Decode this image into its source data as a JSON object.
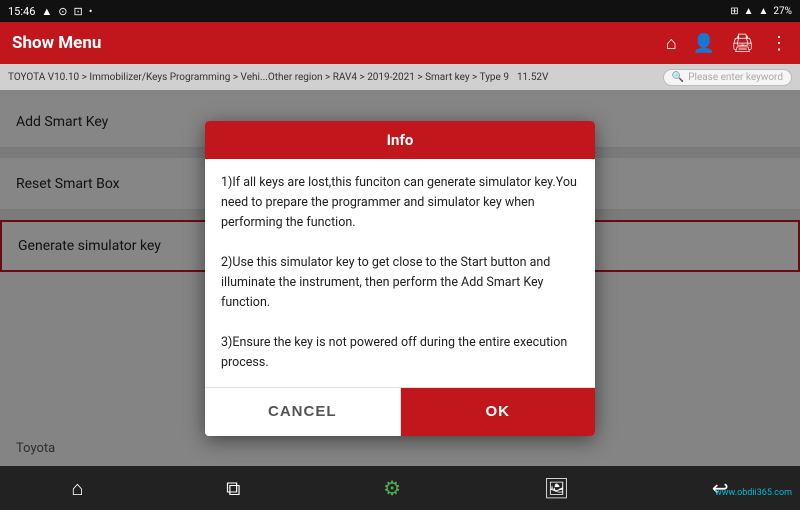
{
  "statusBar": {
    "time": "15:46",
    "battery": "27%",
    "icons": [
      "signal",
      "wifi",
      "battery"
    ]
  },
  "appBar": {
    "title": "Show Menu",
    "icons": [
      "home",
      "person",
      "print",
      "more"
    ]
  },
  "breadcrumb": {
    "text": "TOYOTA V10.10 > Immobilizer/Keys Programming > Vehi...Other region > RAV4 > 2019-2021 > Smart key > Type 9",
    "voltage": "11.52V",
    "searchPlaceholder": "Please enter keyword"
  },
  "menuItems": [
    {
      "label": "Add Smart Key",
      "selected": false
    },
    {
      "label": "Reset Smart Box",
      "selected": false
    },
    {
      "label": "Generate simulator key",
      "selected": true
    }
  ],
  "footerLabel": "Toyota",
  "dialog": {
    "title": "Info",
    "body": "1)If all keys are lost,this funciton can generate simulator key.You need to prepare the programmer and simulator key when performing the function.\n2)Use this simulator key to get close to the Start button and illuminate the instrument, then perform the Add Smart Key function.\n3)Ensure the key is not powered off during the entire execution process.",
    "cancelLabel": "CANCEL",
    "okLabel": "OK"
  },
  "bottomNav": {
    "icons": [
      "home",
      "copy",
      "tool",
      "image",
      "back"
    ]
  },
  "watermark": "www.obdii365.com"
}
